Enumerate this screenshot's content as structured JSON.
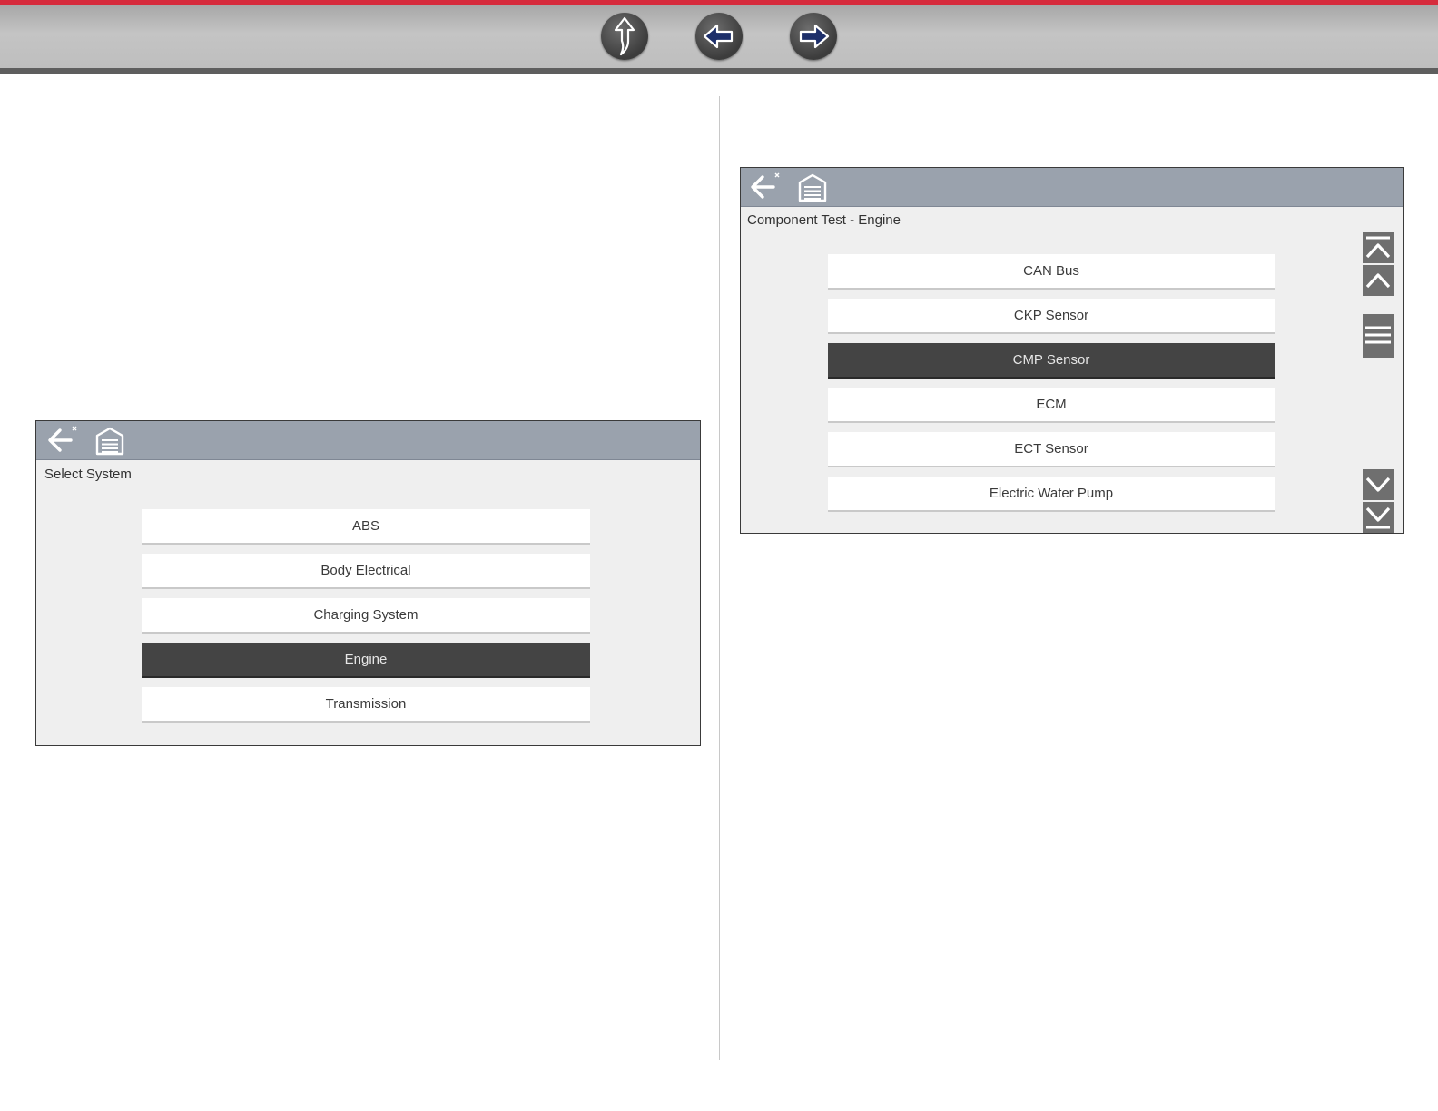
{
  "colors": {
    "accent_red": "#d62b3c",
    "panel_header": "#9aa2ad",
    "selected_item": "#444444"
  },
  "top_nav": {
    "buttons": [
      {
        "name": "up-arrow-icon"
      },
      {
        "name": "back-arrow-icon"
      },
      {
        "name": "forward-arrow-icon"
      }
    ]
  },
  "left_panel": {
    "toolbar_icons": [
      "back-icon",
      "home-garage-icon"
    ],
    "title": "Select System",
    "items": [
      {
        "label": "ABS",
        "selected": false
      },
      {
        "label": "Body Electrical",
        "selected": false
      },
      {
        "label": "Charging System",
        "selected": false
      },
      {
        "label": "Engine",
        "selected": true
      },
      {
        "label": "Transmission",
        "selected": false
      }
    ]
  },
  "right_panel": {
    "toolbar_icons": [
      "back-icon",
      "home-garage-icon"
    ],
    "title": "Component Test - Engine",
    "items": [
      {
        "label": "CAN Bus",
        "selected": false
      },
      {
        "label": "CKP Sensor",
        "selected": false
      },
      {
        "label": "CMP Sensor",
        "selected": true
      },
      {
        "label": "ECM",
        "selected": false
      },
      {
        "label": "ECT Sensor",
        "selected": false
      },
      {
        "label": "Electric Water Pump",
        "selected": false
      }
    ],
    "scrollbar": {
      "icons": [
        "scroll-top-icon",
        "scroll-up-icon",
        "scroll-thumb-grip-icon",
        "scroll-down-icon",
        "scroll-bottom-icon"
      ]
    }
  }
}
